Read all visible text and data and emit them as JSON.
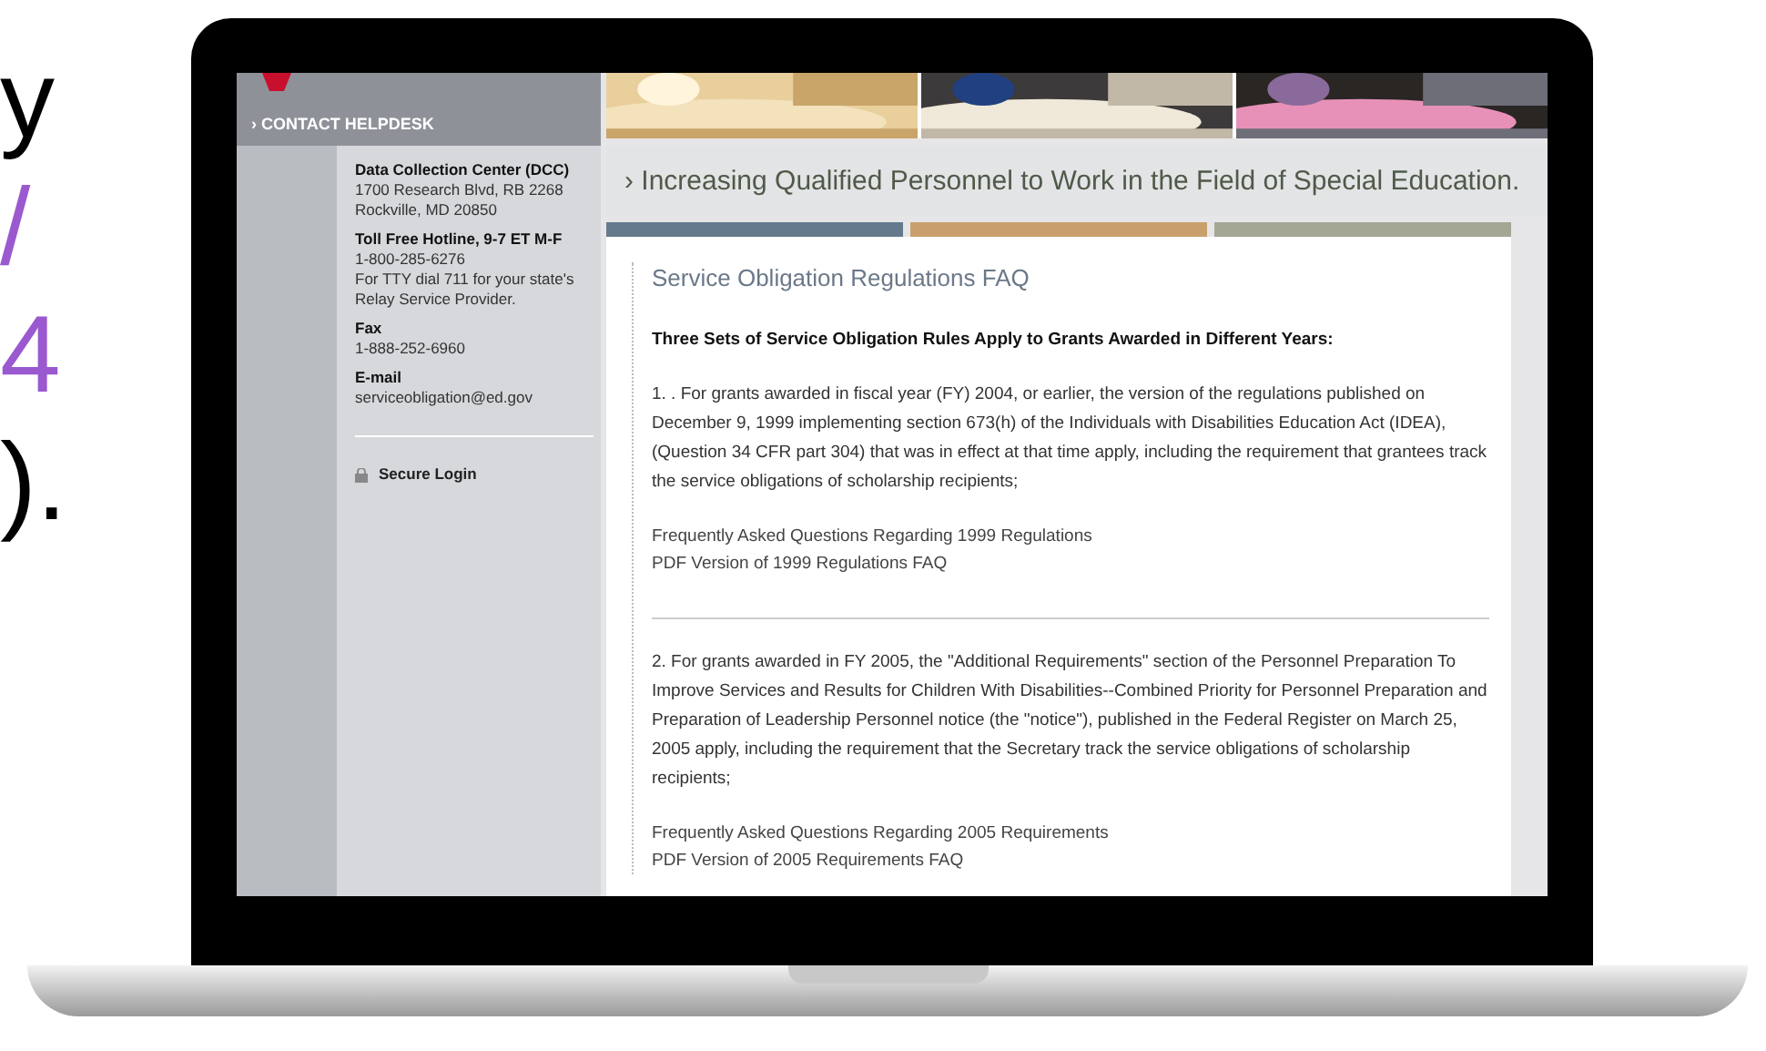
{
  "slide_text": [
    {
      "text": "y",
      "color": "#000000"
    },
    {
      "text": "/",
      "color": "#9b59d0"
    },
    {
      "text": "4",
      "color": "#9b59d0"
    },
    {
      "text": ").",
      "color": "#000000"
    }
  ],
  "site": {
    "nav_link": "› CONTACT HELPDESK",
    "contact": [
      {
        "heading": "Data Collection Center (DCC)",
        "lines": [
          "1700 Research Blvd, RB 2268",
          "Rockville, MD 20850"
        ]
      },
      {
        "heading": "Toll Free Hotline, 9-7 ET M-F",
        "lines": [
          "1-800-285-6276",
          "For TTY dial 711 for your state's Relay Service Provider."
        ]
      },
      {
        "heading": "Fax",
        "lines": [
          "1-888-252-6960"
        ]
      },
      {
        "heading": "E-mail",
        "lines": [
          "serviceobligation@ed.gov"
        ]
      }
    ],
    "login": "Secure Login",
    "banner": "› Increasing Qualified Personnel to Work in the Field of Special Education.",
    "color_bars": [
      {
        "color": "#657a8c"
      },
      {
        "color": "#c9a06c"
      },
      {
        "color": "#a3a794"
      }
    ],
    "page_title": "Service Obligation Regulations FAQ",
    "intro": "Three Sets of Service Obligation Rules Apply to Grants Awarded in Different Years:",
    "sections": [
      {
        "text": "1. . For grants awarded in fiscal year (FY) 2004, or earlier, the version of the regulations published on December 9, 1999 implementing section 673(h) of the Individuals with Disabilities Education Act (IDEA), (Question 34 CFR part 304) that was in effect at that time apply, including the requirement that grantees track the service obligations of scholarship recipients;",
        "links": [
          "Frequently Asked Questions Regarding 1999 Regulations",
          "PDF Version of 1999 Regulations FAQ"
        ]
      },
      {
        "text": "2. For grants awarded in FY 2005, the \"Additional Requirements\" section of the Personnel Preparation To Improve Services and Results for Children With Disabilities--Combined Priority for Personnel Preparation and Preparation of Leadership Personnel notice (the \"notice\"), published in the Federal Register on March 25, 2005 apply, including the requirement that the Secretary track the service obligations of scholarship recipients;",
        "links": [
          "Frequently Asked Questions Regarding 2005 Requirements",
          "PDF Version of 2005 Requirements FAQ"
        ]
      }
    ]
  }
}
